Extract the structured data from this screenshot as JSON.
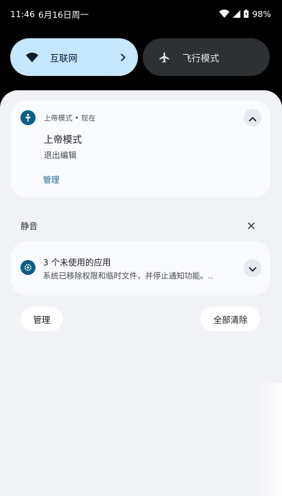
{
  "status_bar": {
    "time": "11:46",
    "date": "6月16日周一",
    "battery": "98%",
    "icons": [
      "wifi-icon",
      "signal-icon",
      "battery-icon"
    ]
  },
  "quick_tiles": {
    "internet": {
      "label": "互联网",
      "icon": "wifi-icon",
      "active": true
    },
    "airplane": {
      "label": "飞行模式",
      "icon": "airplane-icon",
      "active": false
    }
  },
  "notifications": {
    "god_mode": {
      "header": "上帝模式 • 现在",
      "title": "上帝模式",
      "body": "退出编辑",
      "action": "管理",
      "icon": "app-icon",
      "expanded": true
    },
    "silent_section": {
      "label": "静音"
    },
    "unused_apps": {
      "title": "3 个未使用的应用",
      "body": "系统已移除权限和临时文件，并停止通知功能。..",
      "icon": "gear-icon",
      "expanded": false
    }
  },
  "footer": {
    "manage_label": "管理",
    "clear_all_label": "全部清除"
  },
  "colors": {
    "accent": "#0b5f86",
    "tile_active": "#c5e7ff",
    "tile_inactive": "#2e3134",
    "shade_bg": "#f1f2f6"
  }
}
